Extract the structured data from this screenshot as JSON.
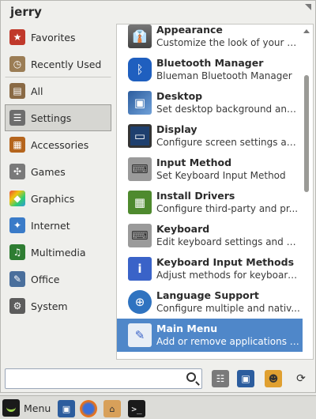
{
  "header": {
    "username": "jerry"
  },
  "categories": [
    {
      "label": "Favorites",
      "icon": "favorites-icon",
      "color": "#c0392b"
    },
    {
      "label": "Recently Used",
      "icon": "recently-used-icon",
      "color": "#9b7d55"
    },
    {
      "label": "All",
      "icon": "all-icon",
      "color": "#8a6a45"
    },
    {
      "label": "Settings",
      "icon": "settings-icon",
      "color": "#6d6d6d",
      "selected": true
    },
    {
      "label": "Accessories",
      "icon": "accessories-icon",
      "color": "#b5651d"
    },
    {
      "label": "Games",
      "icon": "games-icon",
      "color": "#7a7a7a"
    },
    {
      "label": "Graphics",
      "icon": "graphics-icon",
      "color": "#d35400"
    },
    {
      "label": "Internet",
      "icon": "internet-icon",
      "color": "#3a7bc8"
    },
    {
      "label": "Multimedia",
      "icon": "multimedia-icon",
      "color": "#2e7d32"
    },
    {
      "label": "Office",
      "icon": "office-icon",
      "color": "#4a6f9c"
    },
    {
      "label": "System",
      "icon": "system-icon",
      "color": "#5c5c5c"
    }
  ],
  "apps": [
    {
      "title": "Appearance",
      "desc": "Customize the look of your d...",
      "icon": "appearance-icon",
      "color": "#555555"
    },
    {
      "title": "Bluetooth Manager",
      "desc": "Blueman Bluetooth Manager",
      "icon": "bluetooth-icon",
      "color": "#1f5fbf"
    },
    {
      "title": "Desktop",
      "desc": "Set desktop background and ...",
      "icon": "desktop-icon",
      "color": "#2c5d9e"
    },
    {
      "title": "Display",
      "desc": "Configure screen settings an...",
      "icon": "display-icon",
      "color": "#1e3f6e"
    },
    {
      "title": "Input Method",
      "desc": "Set Keyboard Input Method",
      "icon": "keyboard-icon",
      "color": "#8a8a8a"
    },
    {
      "title": "Install Drivers",
      "desc": "Configure third-party and pr...",
      "icon": "driver-chip-icon",
      "color": "#4e8a2e"
    },
    {
      "title": "Keyboard",
      "desc": "Edit keyboard settings and a...",
      "icon": "keyboard-icon",
      "color": "#8a8a8a"
    },
    {
      "title": "Keyboard Input Methods",
      "desc": "Adjust methods for keyboard...",
      "icon": "info-icon",
      "color": "#3a63c8"
    },
    {
      "title": "Language Support",
      "desc": "Configure multiple and nativ...",
      "icon": "globe-icon",
      "color": "#2f73c0"
    },
    {
      "title": "Main Menu",
      "desc": "Add or remove applications f...",
      "icon": "menu-editor-icon",
      "color": "#e8eef6",
      "highlighted": true
    }
  ],
  "search": {
    "value": "",
    "placeholder": ""
  },
  "bottom_buttons": [
    "mixer-settings-icon",
    "lock-screen-icon",
    "user-icon",
    "power-icon"
  ],
  "taskbar": {
    "menu_label": "Menu",
    "launchers": [
      "show-desktop-icon",
      "firefox-icon",
      "home-folder-icon",
      "terminal-icon"
    ]
  },
  "colors": {
    "highlight": "#4f87c9",
    "panel_bg": "#efefec"
  }
}
